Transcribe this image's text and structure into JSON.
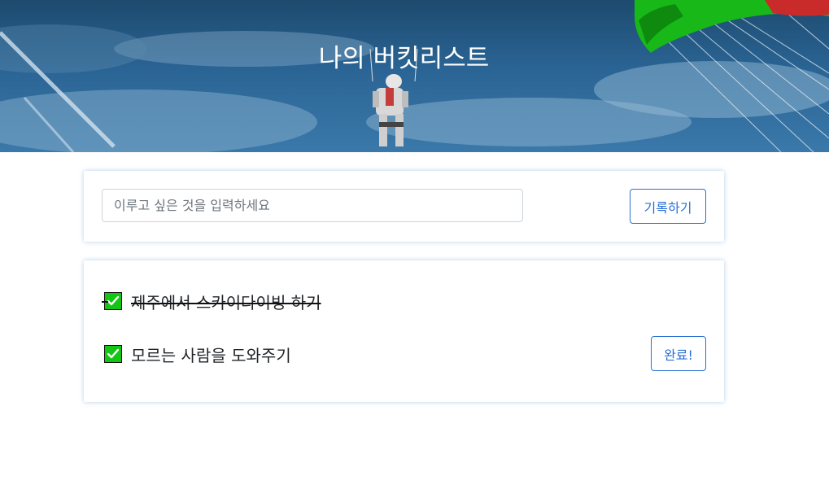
{
  "header": {
    "title": "나의 버킷리스트"
  },
  "form": {
    "placeholder": "이루고 싶은 것을 입력하세요",
    "value": "",
    "save_label": "기록하기"
  },
  "bucket_list": {
    "items": [
      {
        "text": "제주에서 스카이다이빙 하기",
        "done": true
      },
      {
        "text": "모르는 사람을 도와주기",
        "done": false,
        "action_label": "완료!"
      }
    ]
  },
  "colors": {
    "accent": "#2a6fd6",
    "check": "#13c613",
    "sky": "#2a6494"
  },
  "icons": {
    "check": "check-icon"
  }
}
